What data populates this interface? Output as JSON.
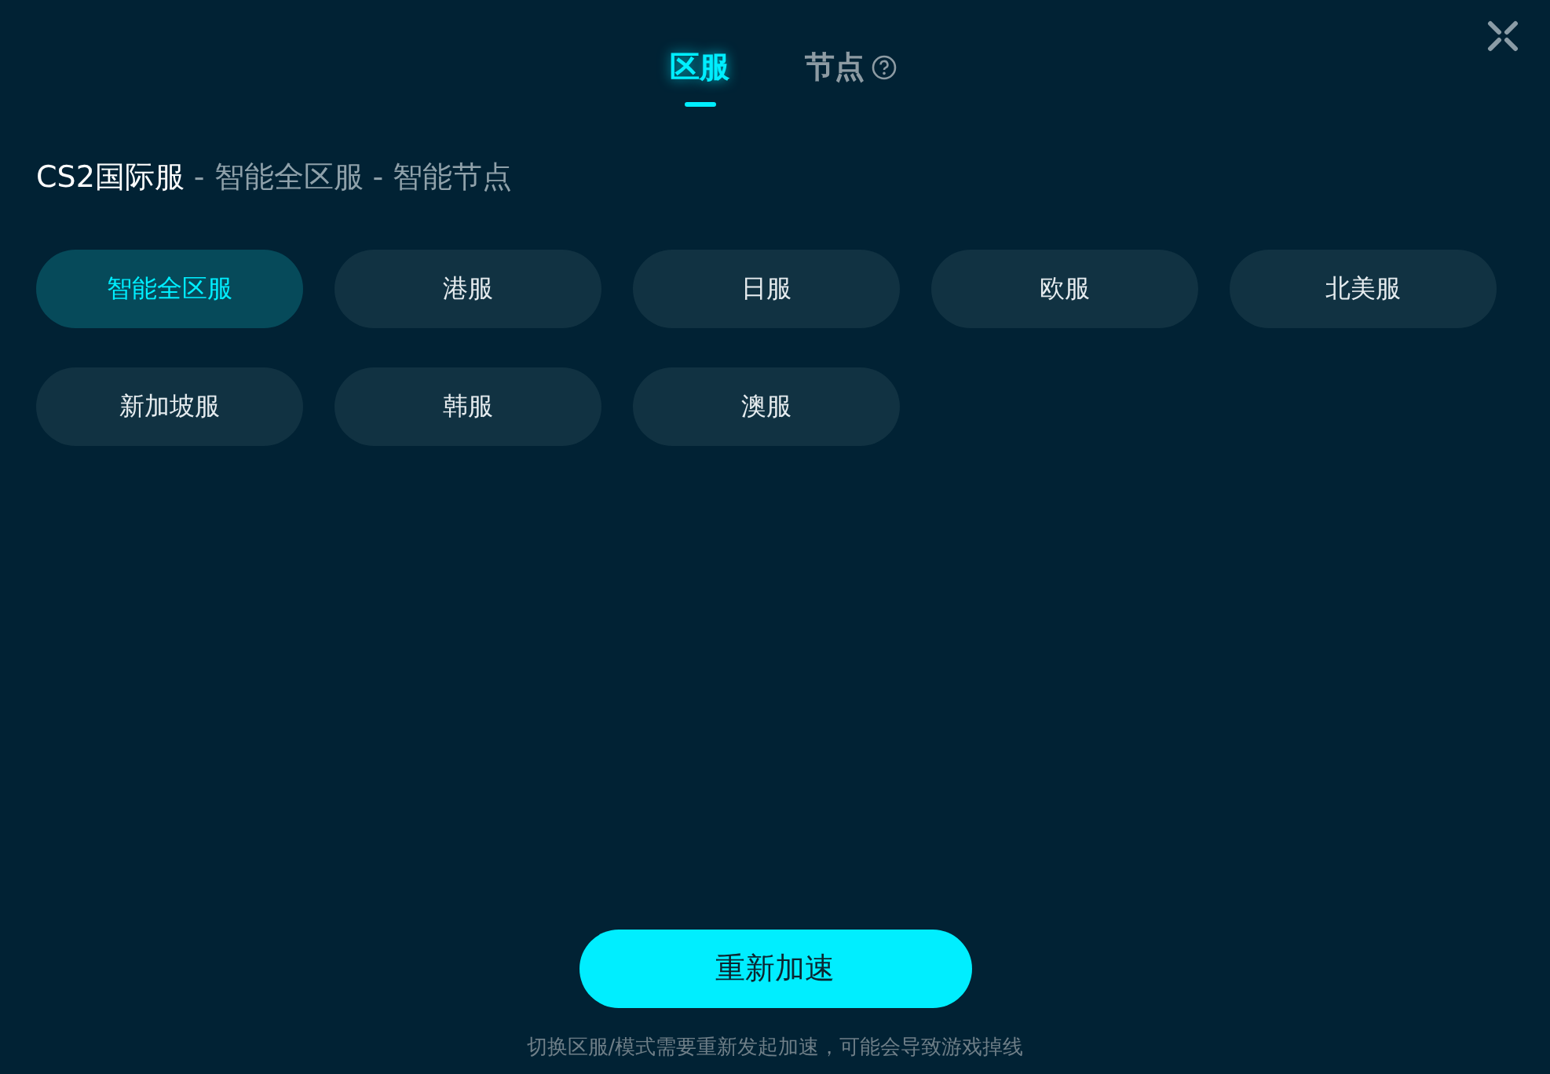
{
  "tabs": [
    {
      "label": "区服",
      "selected": true,
      "help": false
    },
    {
      "label": "节点",
      "selected": false,
      "help": true
    }
  ],
  "breadcrumb": [
    {
      "text": "CS2国际服",
      "kind": "game"
    },
    {
      "text": "-",
      "kind": "sep"
    },
    {
      "text": "智能全区服",
      "kind": "path"
    },
    {
      "text": "-",
      "kind": "sep"
    },
    {
      "text": "智能节点",
      "kind": "path"
    }
  ],
  "regions": [
    {
      "label": "智能全区服",
      "selected": true
    },
    {
      "label": "港服",
      "selected": false
    },
    {
      "label": "日服",
      "selected": false
    },
    {
      "label": "欧服",
      "selected": false
    },
    {
      "label": "北美服",
      "selected": false
    },
    {
      "label": "新加坡服",
      "selected": false
    },
    {
      "label": "韩服",
      "selected": false
    },
    {
      "label": "澳服",
      "selected": false
    }
  ],
  "action_button": "重新加速",
  "hint": "切换区服/模式需要重新发起加速，可能会导致游戏掉线"
}
